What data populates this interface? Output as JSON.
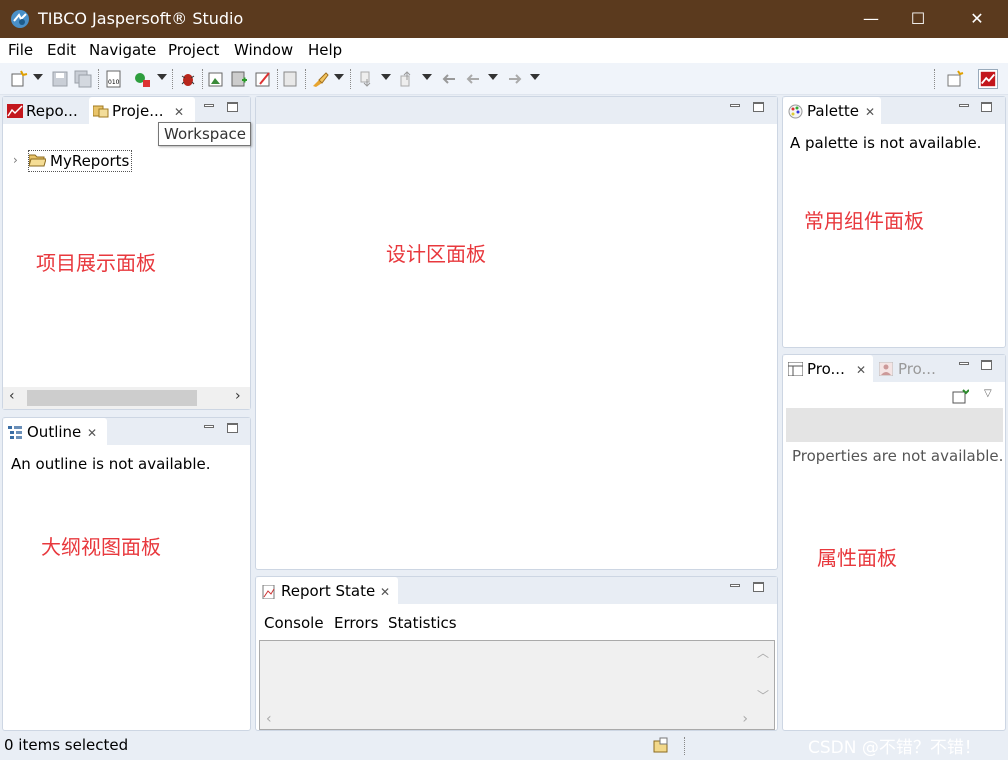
{
  "window": {
    "title": "TIBCO Jaspersoft® Studio",
    "minimize": "—",
    "maximize": "☐",
    "close": "✕"
  },
  "menu": [
    "File",
    "Edit",
    "Navigate",
    "Project",
    "Window",
    "Help"
  ],
  "project_panel": {
    "tabs": [
      "Repo...",
      "Proje..."
    ],
    "tooltip": "Workspace",
    "tree_item": "MyReports",
    "annotation": "项目展示面板"
  },
  "outline_panel": {
    "tab": "Outline",
    "message": "An outline is not available.",
    "annotation": "大纲视图面板"
  },
  "design_panel": {
    "annotation": "设计区面板"
  },
  "report_state_panel": {
    "tab": "Report State",
    "subtabs": [
      "Console",
      "Errors",
      "Statistics"
    ]
  },
  "palette_panel": {
    "tab": "Palette",
    "message": "A palette is not available.",
    "annotation": "常用组件面板"
  },
  "properties_panel": {
    "tabs": [
      "Pro...",
      "Pro..."
    ],
    "message": "Properties are not available.",
    "annotation": "属性面板"
  },
  "status": {
    "text": "0 items selected"
  },
  "watermark": "CSDN @不错？不错！",
  "colors": {
    "titlebar": "#5b3a1e",
    "annotation_red": "#e8383d",
    "panel_border": "#cdd6e3"
  }
}
